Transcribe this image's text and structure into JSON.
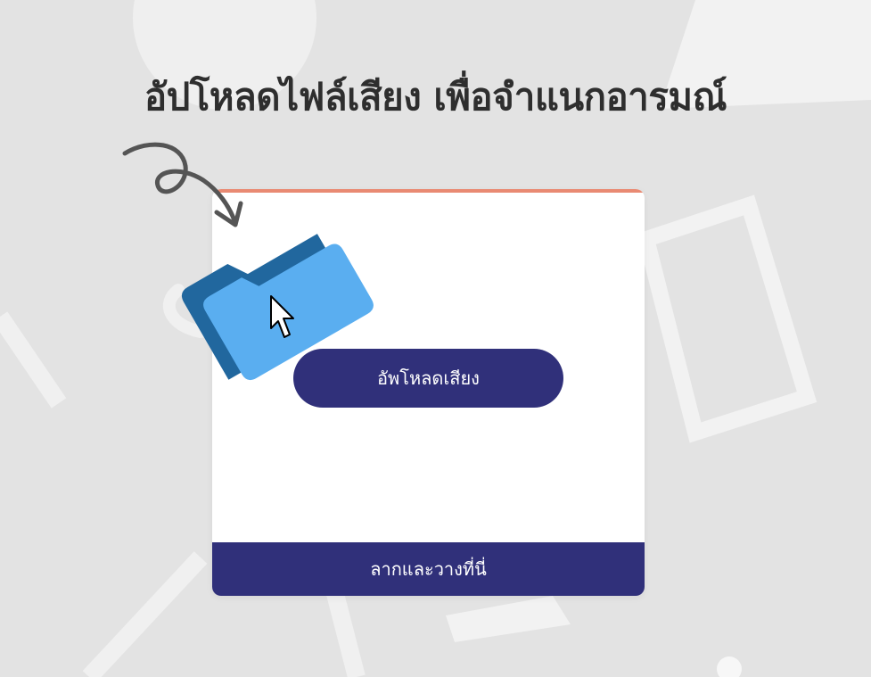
{
  "header": {
    "title": "อัปโหลดไฟล์เสียง เพื่อจำแนกอารมณ์"
  },
  "upload_card": {
    "upload_button_label": "อัพโหลดเสียง",
    "drop_zone_label": "ลากและวางที่นี่"
  },
  "icons": {
    "arrow": "curved-arrow-icon",
    "folder": "folder-icon",
    "cursor": "mouse-cursor-icon"
  },
  "colors": {
    "background": "#e3e3e3",
    "title": "#2e2e2e",
    "primary": "#30307a",
    "card_accent": "#e98a73",
    "folder_front": "#5aaef0",
    "folder_back": "#21679e"
  }
}
